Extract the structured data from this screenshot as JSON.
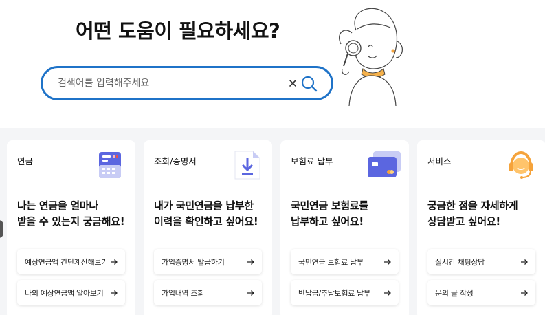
{
  "hero": {
    "title": "어떤 도움이 필요하세요?"
  },
  "search": {
    "placeholder": "검색어를 입력해주세요",
    "value": ""
  },
  "cards": [
    {
      "category": "연금",
      "heading_line1": "나는 연금을 얼마나",
      "heading_line2": "받을 수 있는지 궁금해요!",
      "links": [
        "예상연금액 간단계산해보기",
        "나의 예상연금액 알아보기"
      ],
      "icon": "calculator-icon"
    },
    {
      "category": "조회/증명서",
      "heading_line1": "내가 국민연금을 납부한",
      "heading_line2": "이력을 확인하고 싶어요!",
      "links": [
        "가입증명서 발급하기",
        "가입내역 조회"
      ],
      "icon": "document-download-icon"
    },
    {
      "category": "보험료 납부",
      "heading_line1": "국민연금 보험료를",
      "heading_line2": "납부하고 싶어요!",
      "links": [
        "국민연금 보험료 납부",
        "반납금/추납보험료 납부"
      ],
      "icon": "credit-card-icon"
    },
    {
      "category": "서비스",
      "heading_line1": "궁금한 점을 자세하게",
      "heading_line2": "상담받고 싶어요!",
      "links": [
        "실시간 채팅상담",
        "문의 글 작성"
      ],
      "icon": "headset-agent-icon"
    }
  ],
  "colors": {
    "accent": "#1f73c8",
    "card_bg": "#f4f5f7",
    "purple": "#5b66e0",
    "orange": "#f5a33b"
  }
}
